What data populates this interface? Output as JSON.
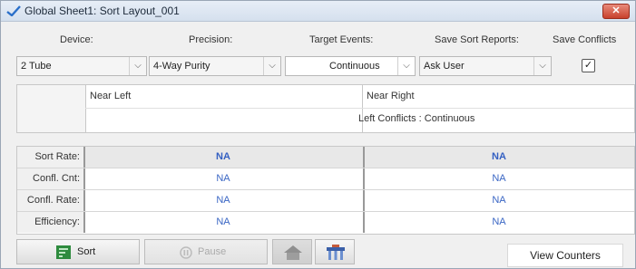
{
  "window": {
    "title": "Global Sheet1: Sort Layout_001",
    "close_label": "✕"
  },
  "settings": {
    "device_label": "Device:",
    "precision_label": "Precision:",
    "target_events_label": "Target Events:",
    "save_reports_label": "Save Sort Reports:",
    "save_conflicts_label": "Save Conflicts",
    "device_value": "2 Tube",
    "precision_value": "4-Way Purity",
    "target_events_value": "Continuous",
    "save_reports_value": "Ask User",
    "save_conflicts_checked": true
  },
  "layout_panel": {
    "left_title": "Near Left",
    "right_title": "Near Right",
    "right_detail": "Left Conflicts : Continuous"
  },
  "stats": {
    "rows": [
      {
        "label": "Sort Rate:",
        "left": "NA",
        "right": "NA"
      },
      {
        "label": "Confl. Cnt:",
        "left": "NA",
        "right": "NA"
      },
      {
        "label": "Confl. Rate:",
        "left": "NA",
        "right": "NA"
      },
      {
        "label": "Efficiency:",
        "left": "NA",
        "right": "NA"
      }
    ]
  },
  "toolbar": {
    "sort_label": "Sort",
    "pause_label": "Pause",
    "view_counters_label": "View Counters"
  },
  "colors": {
    "accent": "#3a66c4",
    "close": "#c8412c",
    "sort_icon": "#2e8b3e"
  }
}
